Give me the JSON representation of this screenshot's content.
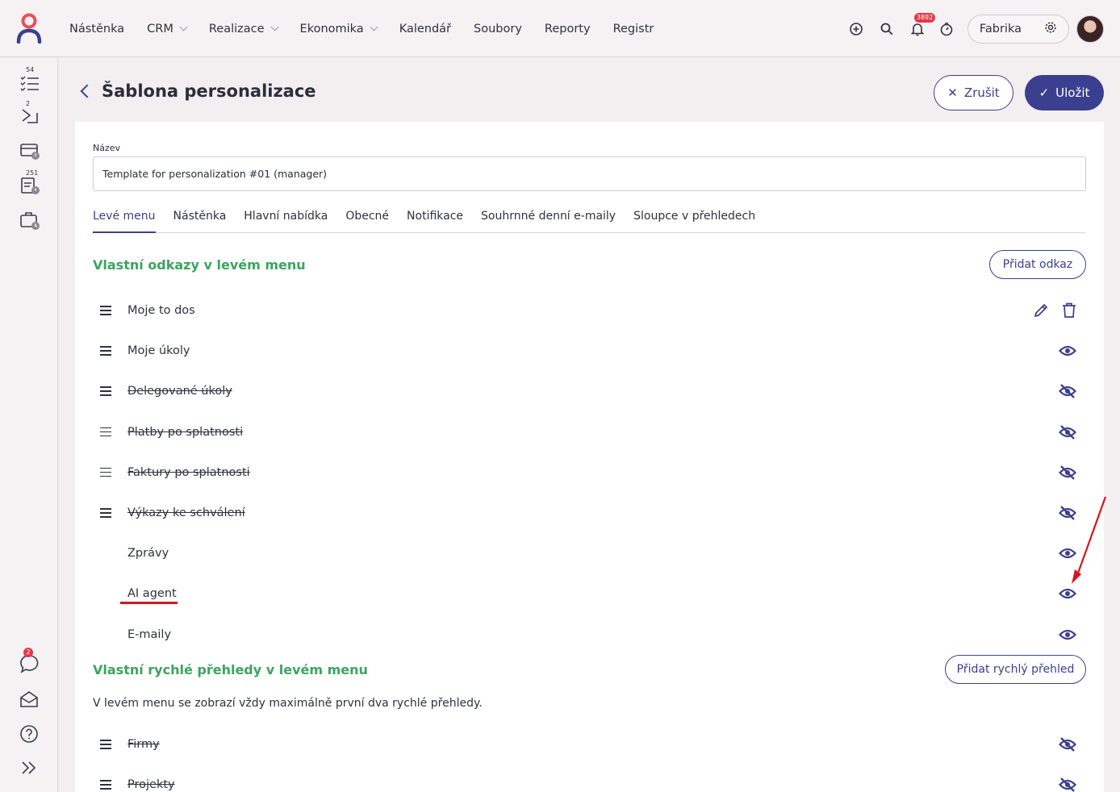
{
  "topbar": {
    "nav": [
      "Nástěnka",
      "CRM",
      "Realizace",
      "Ekonomika",
      "Kalendář",
      "Soubory",
      "Reporty",
      "Registr"
    ],
    "nav_dropdown": [
      false,
      true,
      true,
      true,
      false,
      false,
      false,
      false
    ],
    "notification_count": "3892",
    "company": "Fabrika"
  },
  "sidebar": {
    "badges": {
      "todos": "54",
      "tasks": "2",
      "reports": "251",
      "chat": "2"
    }
  },
  "header": {
    "title": "Šablona personalizace",
    "cancel_label": "Zrušit",
    "save_label": "Uložit"
  },
  "form": {
    "name_label": "Název",
    "name_value": "Template for personalization #01 (manager)"
  },
  "tabs": [
    "Levé menu",
    "Nástěnka",
    "Hlavní nabídka",
    "Obecné",
    "Notifikace",
    "Souhrnné denní e-maily",
    "Sloupce v přehledech"
  ],
  "active_tab": 0,
  "links_section": {
    "title": "Vlastní odkazy v levém menu",
    "add_label": "Přidat odkaz",
    "items": [
      {
        "label": "Moje to dos",
        "draggable": true,
        "hidden": false,
        "actions": "edit-delete"
      },
      {
        "label": "Moje úkoly",
        "draggable": true,
        "hidden": false,
        "actions": "visible"
      },
      {
        "label": "Delegované úkoly",
        "draggable": true,
        "hidden": true,
        "actions": "hidden"
      },
      {
        "label": "Platby po splatnosti",
        "draggable": true,
        "hidden": true,
        "actions": "hidden"
      },
      {
        "label": "Faktury po splatnosti",
        "draggable": true,
        "hidden": true,
        "actions": "hidden"
      },
      {
        "label": "Výkazy ke schválení",
        "draggable": true,
        "hidden": true,
        "actions": "hidden"
      },
      {
        "label": "Zprávy",
        "draggable": false,
        "hidden": false,
        "actions": "visible"
      },
      {
        "label": "AI agent",
        "draggable": false,
        "hidden": false,
        "actions": "visible"
      },
      {
        "label": "E-maily",
        "draggable": false,
        "hidden": false,
        "actions": "visible"
      }
    ]
  },
  "quick_section": {
    "title": "Vlastní rychlé přehledy v levém menu",
    "add_label": "Přidat rychlý přehled",
    "note": "V levém menu se zobrazí vždy maximálně první dva rychlé přehledy.",
    "items": [
      {
        "label": "Firmy",
        "draggable": true,
        "hidden": true,
        "actions": "hidden"
      },
      {
        "label": "Projekty",
        "draggable": true,
        "hidden": true,
        "actions": "hidden"
      }
    ]
  },
  "colors": {
    "primary": "#3b3f8f",
    "section_green": "#3aa55f",
    "annotation_red": "#d9141f",
    "logo_red": "#e8505b",
    "logo_blue": "#3b3f8f"
  }
}
